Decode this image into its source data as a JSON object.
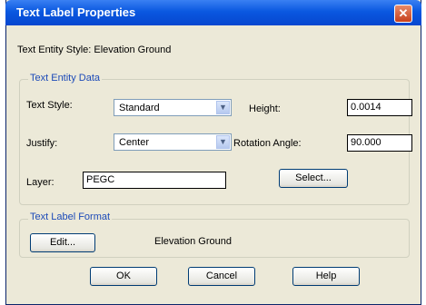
{
  "window": {
    "title": "Text Label Properties",
    "close_glyph": "✕"
  },
  "entity_style": {
    "label": "Text Entity Style:",
    "value": "Elevation Ground"
  },
  "entity_data": {
    "group_title": "Text Entity Data",
    "text_style_label": "Text Style:",
    "text_style_value": "Standard",
    "height_label": "Height:",
    "height_value": "0.0014",
    "justify_label": "Justify:",
    "justify_value": "Center",
    "rotation_label": "Rotation Angle:",
    "rotation_value": "90.000",
    "layer_label": "Layer:",
    "layer_value": "PEGC",
    "select_button": "Select..."
  },
  "label_format": {
    "group_title": "Text Label Format",
    "edit_button": "Edit...",
    "format_value": "Elevation Ground"
  },
  "buttons": {
    "ok": "OK",
    "cancel": "Cancel",
    "help": "Help"
  },
  "icons": {
    "dropdown_arrow": "▼"
  }
}
